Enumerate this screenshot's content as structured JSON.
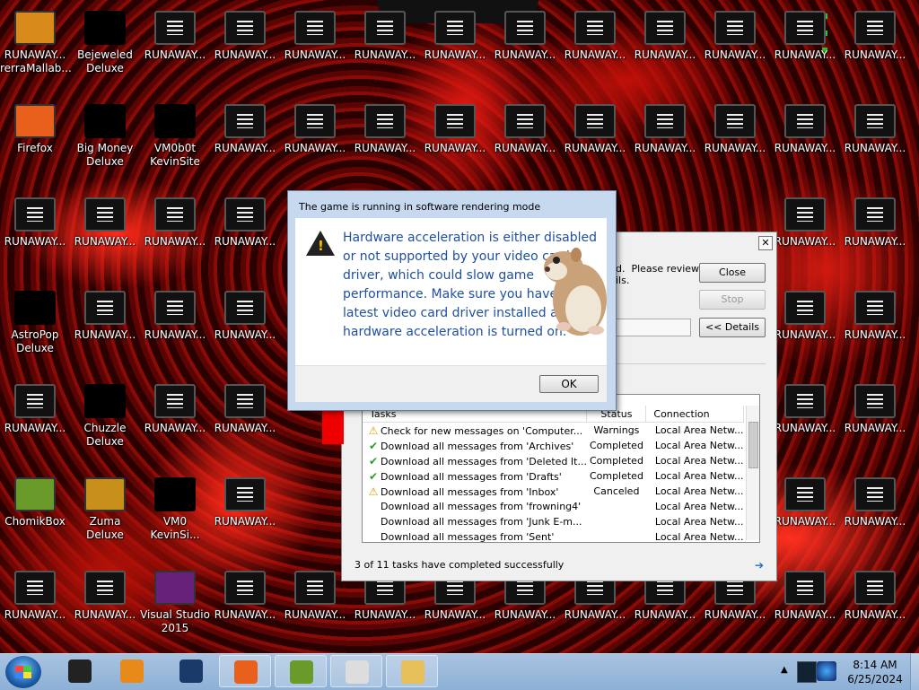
{
  "desktop": {
    "icons": [
      {
        "label": "RUNAWAY...",
        "sub": "rerraMallab...",
        "col": 0,
        "row": 0,
        "style": "color",
        "color": "#d88a1a"
      },
      {
        "label": "Bejeweled",
        "sub": "Deluxe",
        "col": 1,
        "row": 0,
        "style": "dark"
      },
      {
        "label": "RUNAWAY...",
        "col": 2,
        "row": 0
      },
      {
        "label": "RUNAWAY...",
        "col": 3,
        "row": 0
      },
      {
        "label": "RUNAWAY...",
        "col": 4,
        "row": 0
      },
      {
        "label": "RUNAWAY...",
        "col": 5,
        "row": 0
      },
      {
        "label": "RUNAWAY...",
        "col": 6,
        "row": 0
      },
      {
        "label": "RUNAWAY...",
        "col": 7,
        "row": 0
      },
      {
        "label": "RUNAWAY...",
        "col": 8,
        "row": 0
      },
      {
        "label": "RUNAWAY...",
        "col": 9,
        "row": 0
      },
      {
        "label": "RUNAWAY...",
        "col": 10,
        "row": 0
      },
      {
        "label": "RUNAWAY...",
        "col": 11,
        "row": 0
      },
      {
        "label": "RUNAWAY...",
        "col": 12,
        "row": 0
      },
      {
        "label": "Firefox",
        "col": 0,
        "row": 1,
        "style": "color",
        "color": "#e8601c"
      },
      {
        "label": "Big Money",
        "sub": "Deluxe",
        "col": 1,
        "row": 1,
        "style": "dark"
      },
      {
        "label": "VM0b0t",
        "sub": "KevinSite",
        "col": 2,
        "row": 1,
        "style": "dark"
      },
      {
        "label": "RUNAWAY...",
        "col": 3,
        "row": 1
      },
      {
        "label": "RUNAWAY...",
        "col": 4,
        "row": 1
      },
      {
        "label": "RUNAWAY...",
        "col": 5,
        "row": 1
      },
      {
        "label": "RUNAWAY...",
        "col": 6,
        "row": 1
      },
      {
        "label": "RUNAWAY...",
        "col": 7,
        "row": 1
      },
      {
        "label": "RUNAWAY...",
        "col": 8,
        "row": 1
      },
      {
        "label": "RUNAWAY...",
        "col": 9,
        "row": 1
      },
      {
        "label": "RUNAWAY...",
        "col": 10,
        "row": 1
      },
      {
        "label": "RUNAWAY...",
        "col": 11,
        "row": 1
      },
      {
        "label": "RUNAWAY...",
        "col": 12,
        "row": 1
      },
      {
        "label": "RUNAWAY...",
        "col": 0,
        "row": 2
      },
      {
        "label": "RUNAWAY...",
        "col": 1,
        "row": 2
      },
      {
        "label": "RUNAWAY...",
        "col": 2,
        "row": 2
      },
      {
        "label": "RUNAWAY...",
        "col": 3,
        "row": 2
      },
      {
        "label": "RUNAWAY...",
        "col": 11,
        "row": 2
      },
      {
        "label": "RUNAWAY...",
        "col": 12,
        "row": 2
      },
      {
        "label": "AstroPop",
        "sub": "Deluxe",
        "col": 0,
        "row": 3,
        "style": "dark"
      },
      {
        "label": "RUNAWAY...",
        "col": 1,
        "row": 3
      },
      {
        "label": "RUNAWAY...",
        "col": 2,
        "row": 3
      },
      {
        "label": "RUNAWAY...",
        "col": 3,
        "row": 3
      },
      {
        "label": "RUNAWAY...",
        "col": 11,
        "row": 3
      },
      {
        "label": "RUNAWAY...",
        "col": 12,
        "row": 3
      },
      {
        "label": "RUNAWAY...",
        "col": 0,
        "row": 4
      },
      {
        "label": "Chuzzle",
        "sub": "Deluxe",
        "col": 1,
        "row": 4,
        "style": "dark"
      },
      {
        "label": "RUNAWAY...",
        "col": 2,
        "row": 4
      },
      {
        "label": "RUNAWAY...",
        "col": 3,
        "row": 4
      },
      {
        "label": "RUNAWAY...",
        "col": 11,
        "row": 4
      },
      {
        "label": "RUNAWAY...",
        "col": 12,
        "row": 4
      },
      {
        "label": "ChomikBox",
        "col": 0,
        "row": 5,
        "style": "color",
        "color": "#6a9a2a"
      },
      {
        "label": "Zuma Deluxe",
        "col": 1,
        "row": 5,
        "style": "color",
        "color": "#c8901a"
      },
      {
        "label": "VM0",
        "sub": "KevinSi...",
        "col": 2,
        "row": 5,
        "style": "dark"
      },
      {
        "label": "RUNAWAY...",
        "col": 3,
        "row": 5
      },
      {
        "label": "RUNAWAY...",
        "col": 11,
        "row": 5
      },
      {
        "label": "RUNAWAY...",
        "col": 12,
        "row": 5
      },
      {
        "label": "RUNAWAY...",
        "col": 0,
        "row": 6
      },
      {
        "label": "RUNAWAY...",
        "col": 1,
        "row": 6
      },
      {
        "label": "Visual Studio",
        "sub": "2015",
        "col": 2,
        "row": 6,
        "style": "color",
        "color": "#68217a"
      },
      {
        "label": "RUNAWAY...",
        "col": 3,
        "row": 6
      },
      {
        "label": "RUNAWAY...",
        "col": 4,
        "row": 6
      },
      {
        "label": "RUNAWAY...",
        "col": 5,
        "row": 6
      },
      {
        "label": "RUNAWAY...",
        "col": 6,
        "row": 6
      },
      {
        "label": "RUNAWAY...",
        "col": 7,
        "row": 6
      },
      {
        "label": "RUNAWAY...",
        "col": 8,
        "row": 6
      },
      {
        "label": "RUNAWAY...",
        "col": 9,
        "row": 6
      },
      {
        "label": "RUNAWAY...",
        "col": 10,
        "row": 6
      },
      {
        "label": "RUNAWAY...",
        "col": 11,
        "row": 6
      },
      {
        "label": "RUNAWAY...",
        "col": 12,
        "row": 6
      }
    ]
  },
  "report_dialog": {
    "message": "d.  Please review\nils.",
    "close_label": "Close",
    "stop_label": "Stop",
    "details_label": "<< Details",
    "columns": [
      "Tasks",
      "Status",
      "Connection"
    ],
    "rows": [
      {
        "icon": "warning-icon",
        "task": "Check for new messages on 'Computer...",
        "status": "Warnings",
        "conn": "Local Area Netw..."
      },
      {
        "icon": "check-icon",
        "task": "Download all messages from 'Archives'",
        "status": "Completed",
        "conn": "Local Area Netw..."
      },
      {
        "icon": "check-icon",
        "task": "Download all messages from 'Deleted It...",
        "status": "Completed",
        "conn": "Local Area Netw..."
      },
      {
        "icon": "check-icon",
        "task": "Download all messages from 'Drafts'",
        "status": "Completed",
        "conn": "Local Area Netw..."
      },
      {
        "icon": "warning-icon",
        "task": "Download all messages from 'Inbox'",
        "status": "Canceled",
        "conn": "Local Area Netw..."
      },
      {
        "icon": "",
        "task": "Download all messages from 'frowning4'",
        "status": "",
        "conn": "Local Area Netw..."
      },
      {
        "icon": "",
        "task": "Download all messages from 'Junk E-m...",
        "status": "",
        "conn": "Local Area Netw..."
      },
      {
        "icon": "",
        "task": "Download all messages from 'Sent'",
        "status": "",
        "conn": "Local Area Netw..."
      }
    ],
    "status_text": "3 of 11 tasks have completed successfully"
  },
  "alert_dialog": {
    "title": "The game is running in software rendering mode",
    "message": "Hardware acceleration is either disabled or not supported by your video card driver, which could slow game performance. Make sure you have the latest video card driver installed and hardware acceleration is turned on.",
    "ok_label": "OK"
  },
  "taskbar": {
    "apps": [
      {
        "name": "taskbar-app-1",
        "color": "#222"
      },
      {
        "name": "taskbar-media-player",
        "color": "#e88a1a"
      },
      {
        "name": "taskbar-app-3",
        "color": "#1a3a6a"
      },
      {
        "name": "taskbar-firefox",
        "color": "#e8601c"
      },
      {
        "name": "taskbar-chomikbox",
        "color": "#6a9a2a"
      },
      {
        "name": "taskbar-solitaire",
        "color": "#ddd"
      },
      {
        "name": "taskbar-explorer",
        "color": "#e8c05a"
      }
    ],
    "time": "8:14 AM",
    "date": "6/25/2024"
  }
}
